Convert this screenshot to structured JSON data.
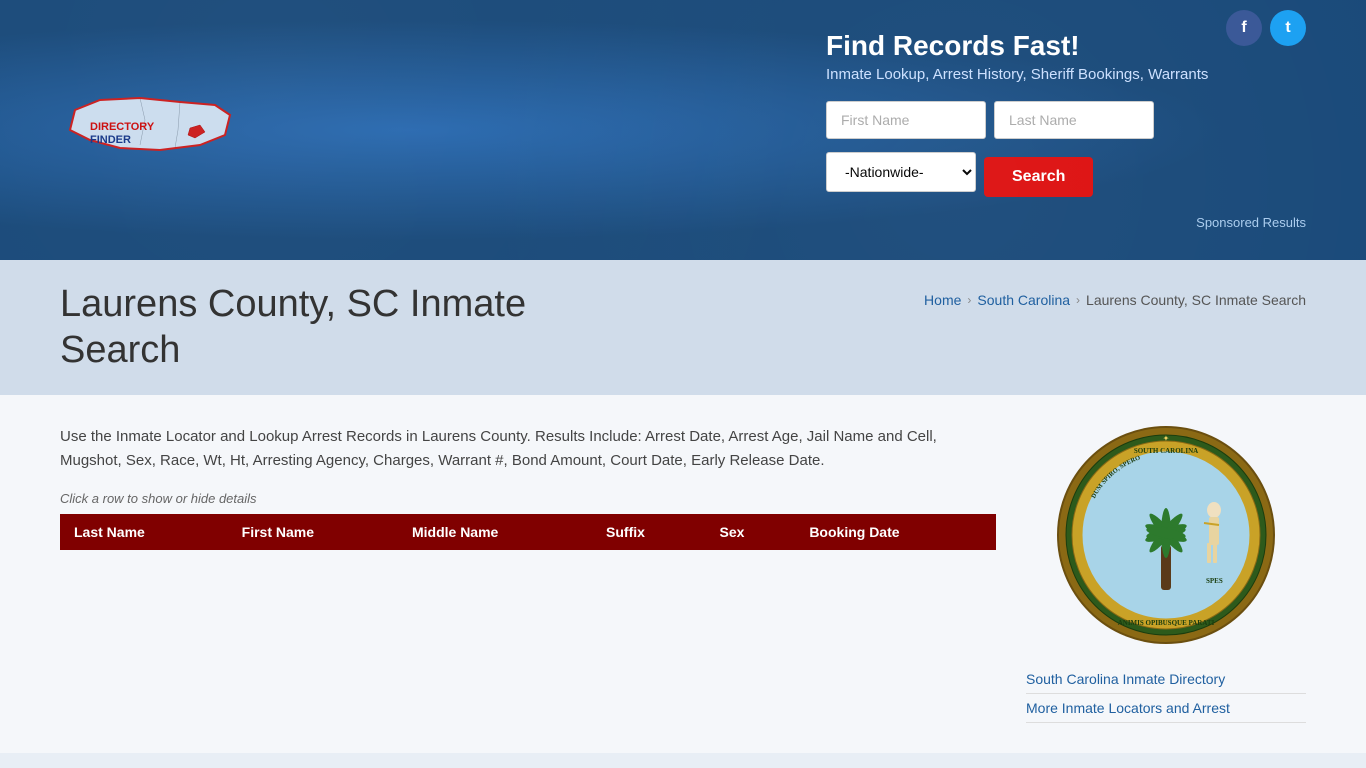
{
  "social": {
    "facebook_label": "f",
    "twitter_label": "t"
  },
  "header": {
    "logo_text_directory": "Directory",
    "logo_text_finder": "Finder",
    "find_records_title": "Find Records Fast!",
    "find_records_subtitle": "Inmate Lookup, Arrest History, Sheriff Bookings, Warrants",
    "first_name_placeholder": "First Name",
    "last_name_placeholder": "Last Name",
    "state_default": "-Nationwide-",
    "search_button_label": "Search",
    "sponsored_label": "Sponsored Results"
  },
  "breadcrumb_section": {
    "page_title_line1": "Laurens County, SC Inmate",
    "page_title_line2": "Search",
    "home_label": "Home",
    "state_label": "South Carolina",
    "current_label": "Laurens County, SC Inmate Search"
  },
  "main": {
    "description": "Use the Inmate Locator and Lookup Arrest Records in Laurens County. Results Include: Arrest Date, Arrest Age, Jail Name and Cell, Mugshot, Sex, Race, Wt, Ht, Arresting Agency, Charges, Warrant #, Bond Amount, Court Date, Early Release Date.",
    "click_hint": "Click a row to show or hide details",
    "table": {
      "headers": [
        "Last Name",
        "First Name",
        "Middle Name",
        "Suffix",
        "Sex",
        "Booking Date"
      ]
    }
  },
  "sidebar": {
    "link1": "South Carolina Inmate Directory",
    "link2": "More Inmate Locators and Arrest"
  },
  "seal": {
    "alt": "South Carolina State Seal"
  }
}
